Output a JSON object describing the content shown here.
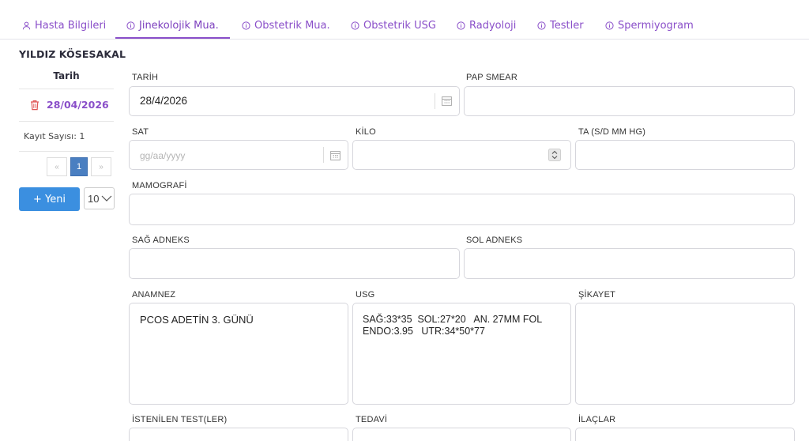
{
  "tabs": [
    {
      "label": "Hasta Bilgileri",
      "icon": "user-icon"
    },
    {
      "label": "Jinekolojik Mua.",
      "icon": "info-icon",
      "active": true
    },
    {
      "label": "Obstetrik Mua.",
      "icon": "info-icon"
    },
    {
      "label": "Obstetrik USG",
      "icon": "info-icon"
    },
    {
      "label": "Radyoloji",
      "icon": "info-icon"
    },
    {
      "label": "Testler",
      "icon": "info-icon"
    },
    {
      "label": "Spermiyogram",
      "icon": "info-icon"
    }
  ],
  "patient": {
    "name": "YILDIZ KÖSESAKAL"
  },
  "records": {
    "column_header": "Tarih",
    "items": [
      {
        "date": "28/04/2026"
      }
    ],
    "count_label": "Kayıt Sayısı: 1"
  },
  "pagination": {
    "prev": "«",
    "current": "1",
    "next": "»"
  },
  "actions": {
    "new_label": "+ Yeni",
    "page_size": "10"
  },
  "form": {
    "tarih": {
      "label": "TARİH",
      "value": "28/4/2026"
    },
    "pap_smear": {
      "label": "PAP SMEAR",
      "value": ""
    },
    "sat": {
      "label": "SAT",
      "placeholder": "gg/aa/yyyy"
    },
    "kilo": {
      "label": "KİLO",
      "value": ""
    },
    "ta": {
      "label": "TA (S/D MM HG)",
      "value": ""
    },
    "mamografi": {
      "label": "MAMOGRAFİ",
      "value": ""
    },
    "sag_adneks": {
      "label": "SAĞ ADNEKS",
      "value": ""
    },
    "sol_adneks": {
      "label": "SOL ADNEKS",
      "value": ""
    },
    "anamnez": {
      "label": "ANAMNEZ",
      "value": "PCOS ADETİN 3. GÜNÜ"
    },
    "usg": {
      "label": "USG",
      "value": "SAĞ:33*35  SOL:27*20   AN. 27MM FOL\nENDO:3.95   UTR:34*50*77"
    },
    "sikayet": {
      "label": "ŞİKAYET",
      "value": ""
    },
    "istenilen_test": {
      "label": "İSTENİLEN TEST(LER)",
      "value": ""
    },
    "tedavi": {
      "label": "TEDAVİ",
      "value": ""
    },
    "ilaclar": {
      "label": "İLAÇLAR",
      "value": ""
    }
  },
  "colors": {
    "accent": "#8a4fc9",
    "primary_button": "#3b8fe0",
    "delete": "#e05555",
    "pager_active": "#4a7fc1"
  }
}
